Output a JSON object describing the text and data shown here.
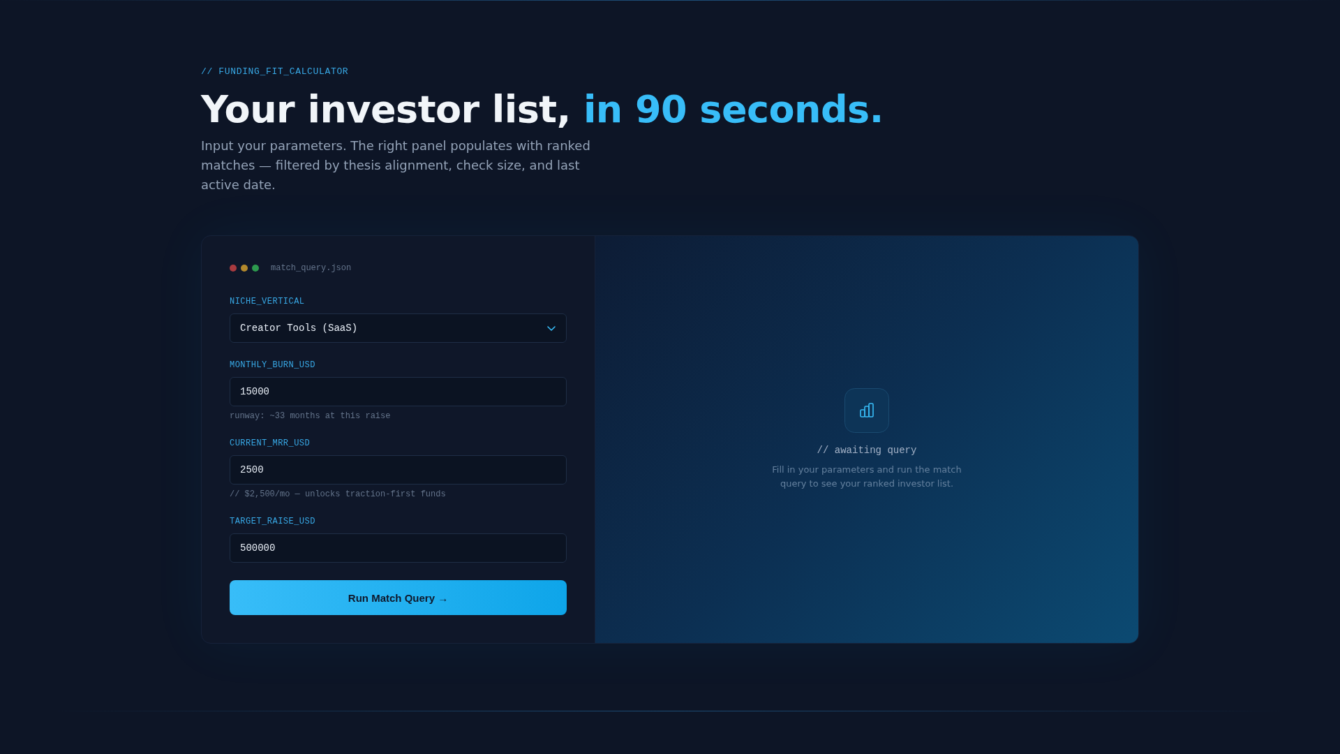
{
  "header": {
    "eyebrow": "// FUNDING_FIT_CALCULATOR",
    "title": "Your investor list,",
    "title_accent": "in 90 seconds.",
    "description": "Input your parameters. The right panel populates with ranked matches — filtered by thesis alignment, check size, and last active date."
  },
  "query_panel": {
    "file_name": "match_query.json",
    "fields": [
      {
        "kind": "select",
        "label": "NICHE_VERTICAL",
        "value": "Creator Tools (SaaS)"
      },
      {
        "kind": "number",
        "label": "MONTHLY_BURN_USD",
        "value": "15000",
        "hint": "runway: ~33 months at this raise"
      },
      {
        "kind": "number",
        "label": "CURRENT_MRR_USD",
        "value": "2500",
        "hint": "// $2,500/mo — unlocks traction-first funds"
      },
      {
        "kind": "number",
        "label": "TARGET_RAISE_USD",
        "value": "500000"
      }
    ],
    "submit_button": "Run Match Query →"
  },
  "results_panel": {
    "status": "// awaiting query",
    "message": "Fill in your parameters and run the match query to see your ranked investor list."
  }
}
